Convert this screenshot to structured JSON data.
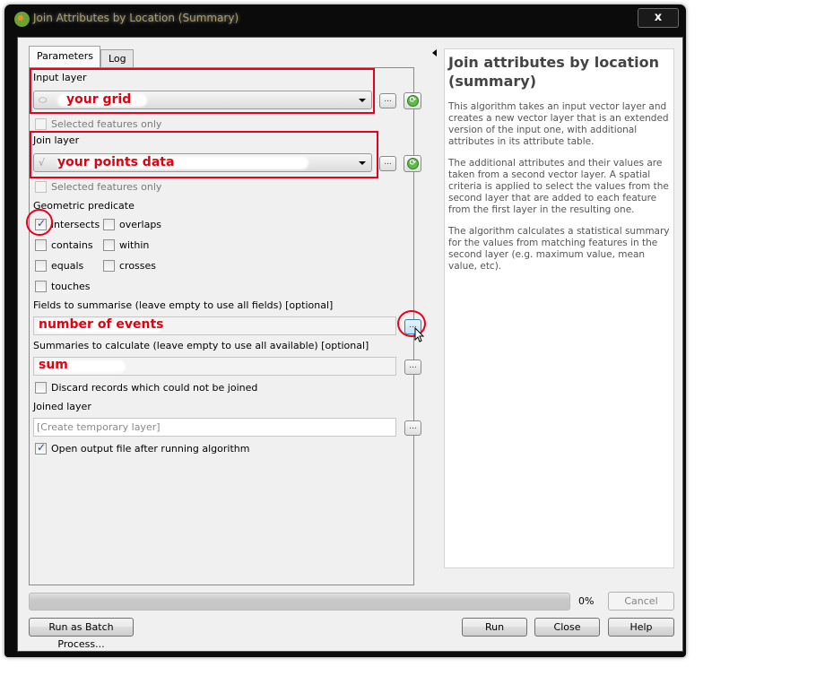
{
  "window": {
    "title": "Join Attributes by Location (Summary)",
    "close_label": "x"
  },
  "tabs": [
    {
      "label": "Parameters",
      "active": true
    },
    {
      "label": "Log",
      "active": false
    }
  ],
  "params": {
    "input_layer": {
      "label": "Input layer",
      "value": "your grid",
      "geometry_icon": "polygon-icon",
      "selected_only_label": "Selected features only",
      "selected_only_checked": false
    },
    "join_layer": {
      "label": "Join layer",
      "value": "your points data",
      "geometry_icon": "line-icon",
      "selected_only_label": "Selected features only",
      "selected_only_checked": false
    },
    "geometric_predicate": {
      "label": "Geometric predicate",
      "options": [
        {
          "label": "intersects",
          "checked": true
        },
        {
          "label": "overlaps",
          "checked": false
        },
        {
          "label": "contains",
          "checked": false
        },
        {
          "label": "within",
          "checked": false
        },
        {
          "label": "equals",
          "checked": false
        },
        {
          "label": "crosses",
          "checked": false
        },
        {
          "label": "touches",
          "checked": false
        }
      ]
    },
    "fields_to_summarise": {
      "label": "Fields to summarise (leave empty to use all fields) [optional]",
      "value": "number of events"
    },
    "summaries": {
      "label": "Summaries to calculate (leave empty to use all available) [optional]",
      "value": "sum"
    },
    "discard": {
      "label": "Discard records which could not be joined",
      "checked": false
    },
    "joined_layer": {
      "label": "Joined layer",
      "placeholder": "[Create temporary layer]"
    },
    "open_output": {
      "label": "Open output file after running algorithm",
      "checked": true
    },
    "browse_label": "...",
    "refresh_glyph": "⟳"
  },
  "help": {
    "title": "Join attributes by location (summary)",
    "paragraphs": [
      "This algorithm takes an input vector layer and creates a new vector layer that is an extended version of the input one, with additional attributes in its attribute table.",
      "The additional attributes and their values are taken from a second vector layer. A spatial criteria is applied to select the values from the second layer that are added to each feature from the first layer in the resulting one.",
      "The algorithm calculates a statistical summary for the values from matching features in the second layer (e.g. maximum value, mean value, etc)."
    ]
  },
  "footer": {
    "progress_percent": 0,
    "progress_text": "0%",
    "cancel_label": "Cancel",
    "batch_label": "Run as Batch Process...",
    "run_label": "Run",
    "close_label": "Close",
    "help_label": "Help"
  },
  "annotation_color": "#e8001c"
}
